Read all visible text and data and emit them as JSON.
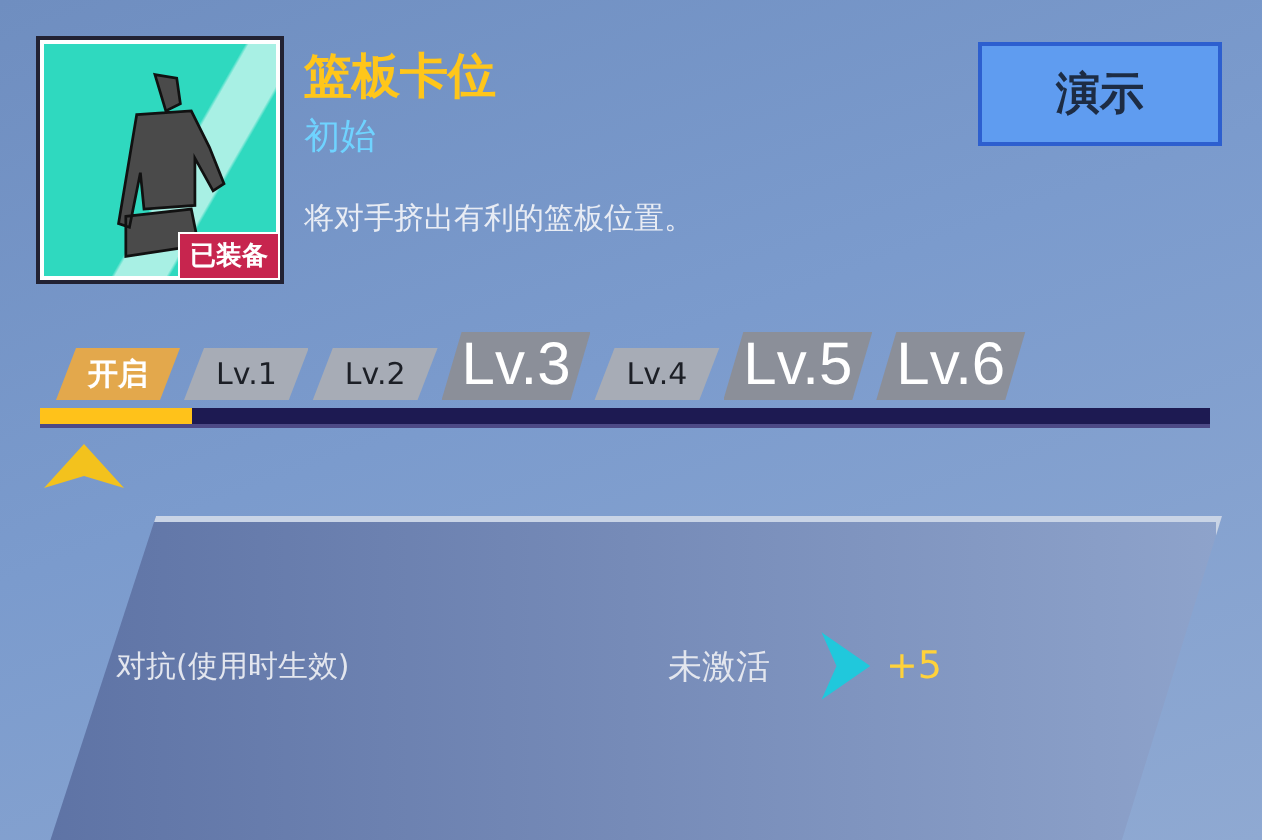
{
  "skill": {
    "name": "篮板卡位",
    "grade": "初始",
    "badge": "已装备",
    "equipped": true,
    "description": "将对手挤出有利的篮板位置。"
  },
  "demo_button": "演示",
  "levels": [
    {
      "label": "开启",
      "kind": "small",
      "selected": true
    },
    {
      "label": "Lv.1",
      "kind": "small",
      "selected": false
    },
    {
      "label": "Lv.2",
      "kind": "small",
      "selected": false
    },
    {
      "label": "Lv.3",
      "kind": "big",
      "selected": false
    },
    {
      "label": "Lv.4",
      "kind": "small",
      "selected": false
    },
    {
      "label": "Lv.5",
      "kind": "big",
      "selected": false
    },
    {
      "label": "Lv.6",
      "kind": "big",
      "selected": false
    }
  ],
  "progress": {
    "level": 0.13
  },
  "effect": {
    "name": "对抗(使用时生效)",
    "status": "未激活",
    "bonus": "+5"
  }
}
